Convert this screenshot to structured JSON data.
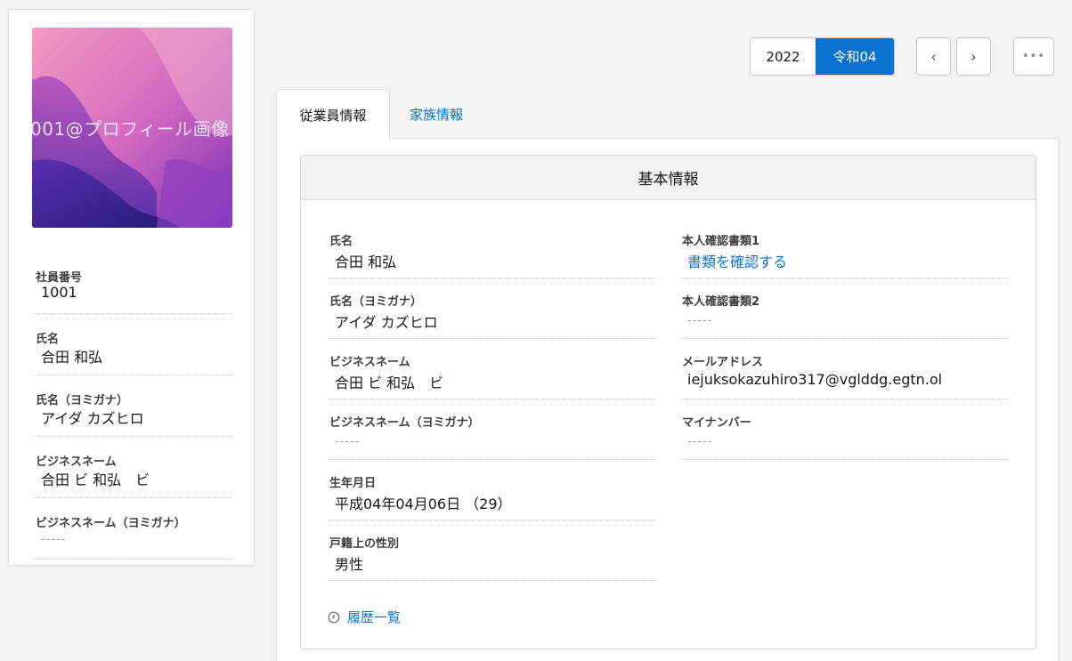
{
  "profile": {
    "image_alt": "001@プロフィール画像",
    "fields": [
      {
        "label": "社員番号",
        "value": "1001"
      },
      {
        "label": "氏名",
        "value": "合田 和弘"
      },
      {
        "label": "氏名（ヨミガナ）",
        "value": "アイダ カズヒロ"
      },
      {
        "label": "ビジネスネーム",
        "value": "合田 ビ 和弘　ビ"
      },
      {
        "label": "ビジネスネーム（ヨミガナ）",
        "value": "-----"
      }
    ]
  },
  "toolbar": {
    "year_western": "2022",
    "year_japanese": "令和04",
    "prev_label": "‹",
    "next_label": "›",
    "more_label": "•••"
  },
  "tabs": [
    {
      "label": "従業員情報",
      "active": true
    },
    {
      "label": "家族情報",
      "active": false
    }
  ],
  "basic_info": {
    "title": "基本情報",
    "left": [
      {
        "label": "氏名",
        "value": "合田 和弘"
      },
      {
        "label": "氏名（ヨミガナ）",
        "value": "アイダ カズヒロ"
      },
      {
        "label": "ビジネスネーム",
        "value": "合田 ビ 和弘　ビ"
      },
      {
        "label": "ビジネスネーム（ヨミガナ）",
        "value": "-----"
      },
      {
        "label": "生年月日",
        "value": "平成04年04月06日 （29）"
      },
      {
        "label": "戸籍上の性別",
        "value": "男性"
      }
    ],
    "right": [
      {
        "label": "本人確認書類1",
        "value": "書類を確認する"
      },
      {
        "label": "本人確認書類2",
        "value": "-----"
      },
      {
        "label": "メールアドレス",
        "value": "iejuksokazuhiro317@vglddg.egtn.ol"
      },
      {
        "label": "マイナンバー",
        "value": "-----"
      }
    ],
    "history_label": "履歴一覧"
  },
  "colors": {
    "accent": "#0b72d1",
    "background": "#f4f3f2"
  }
}
